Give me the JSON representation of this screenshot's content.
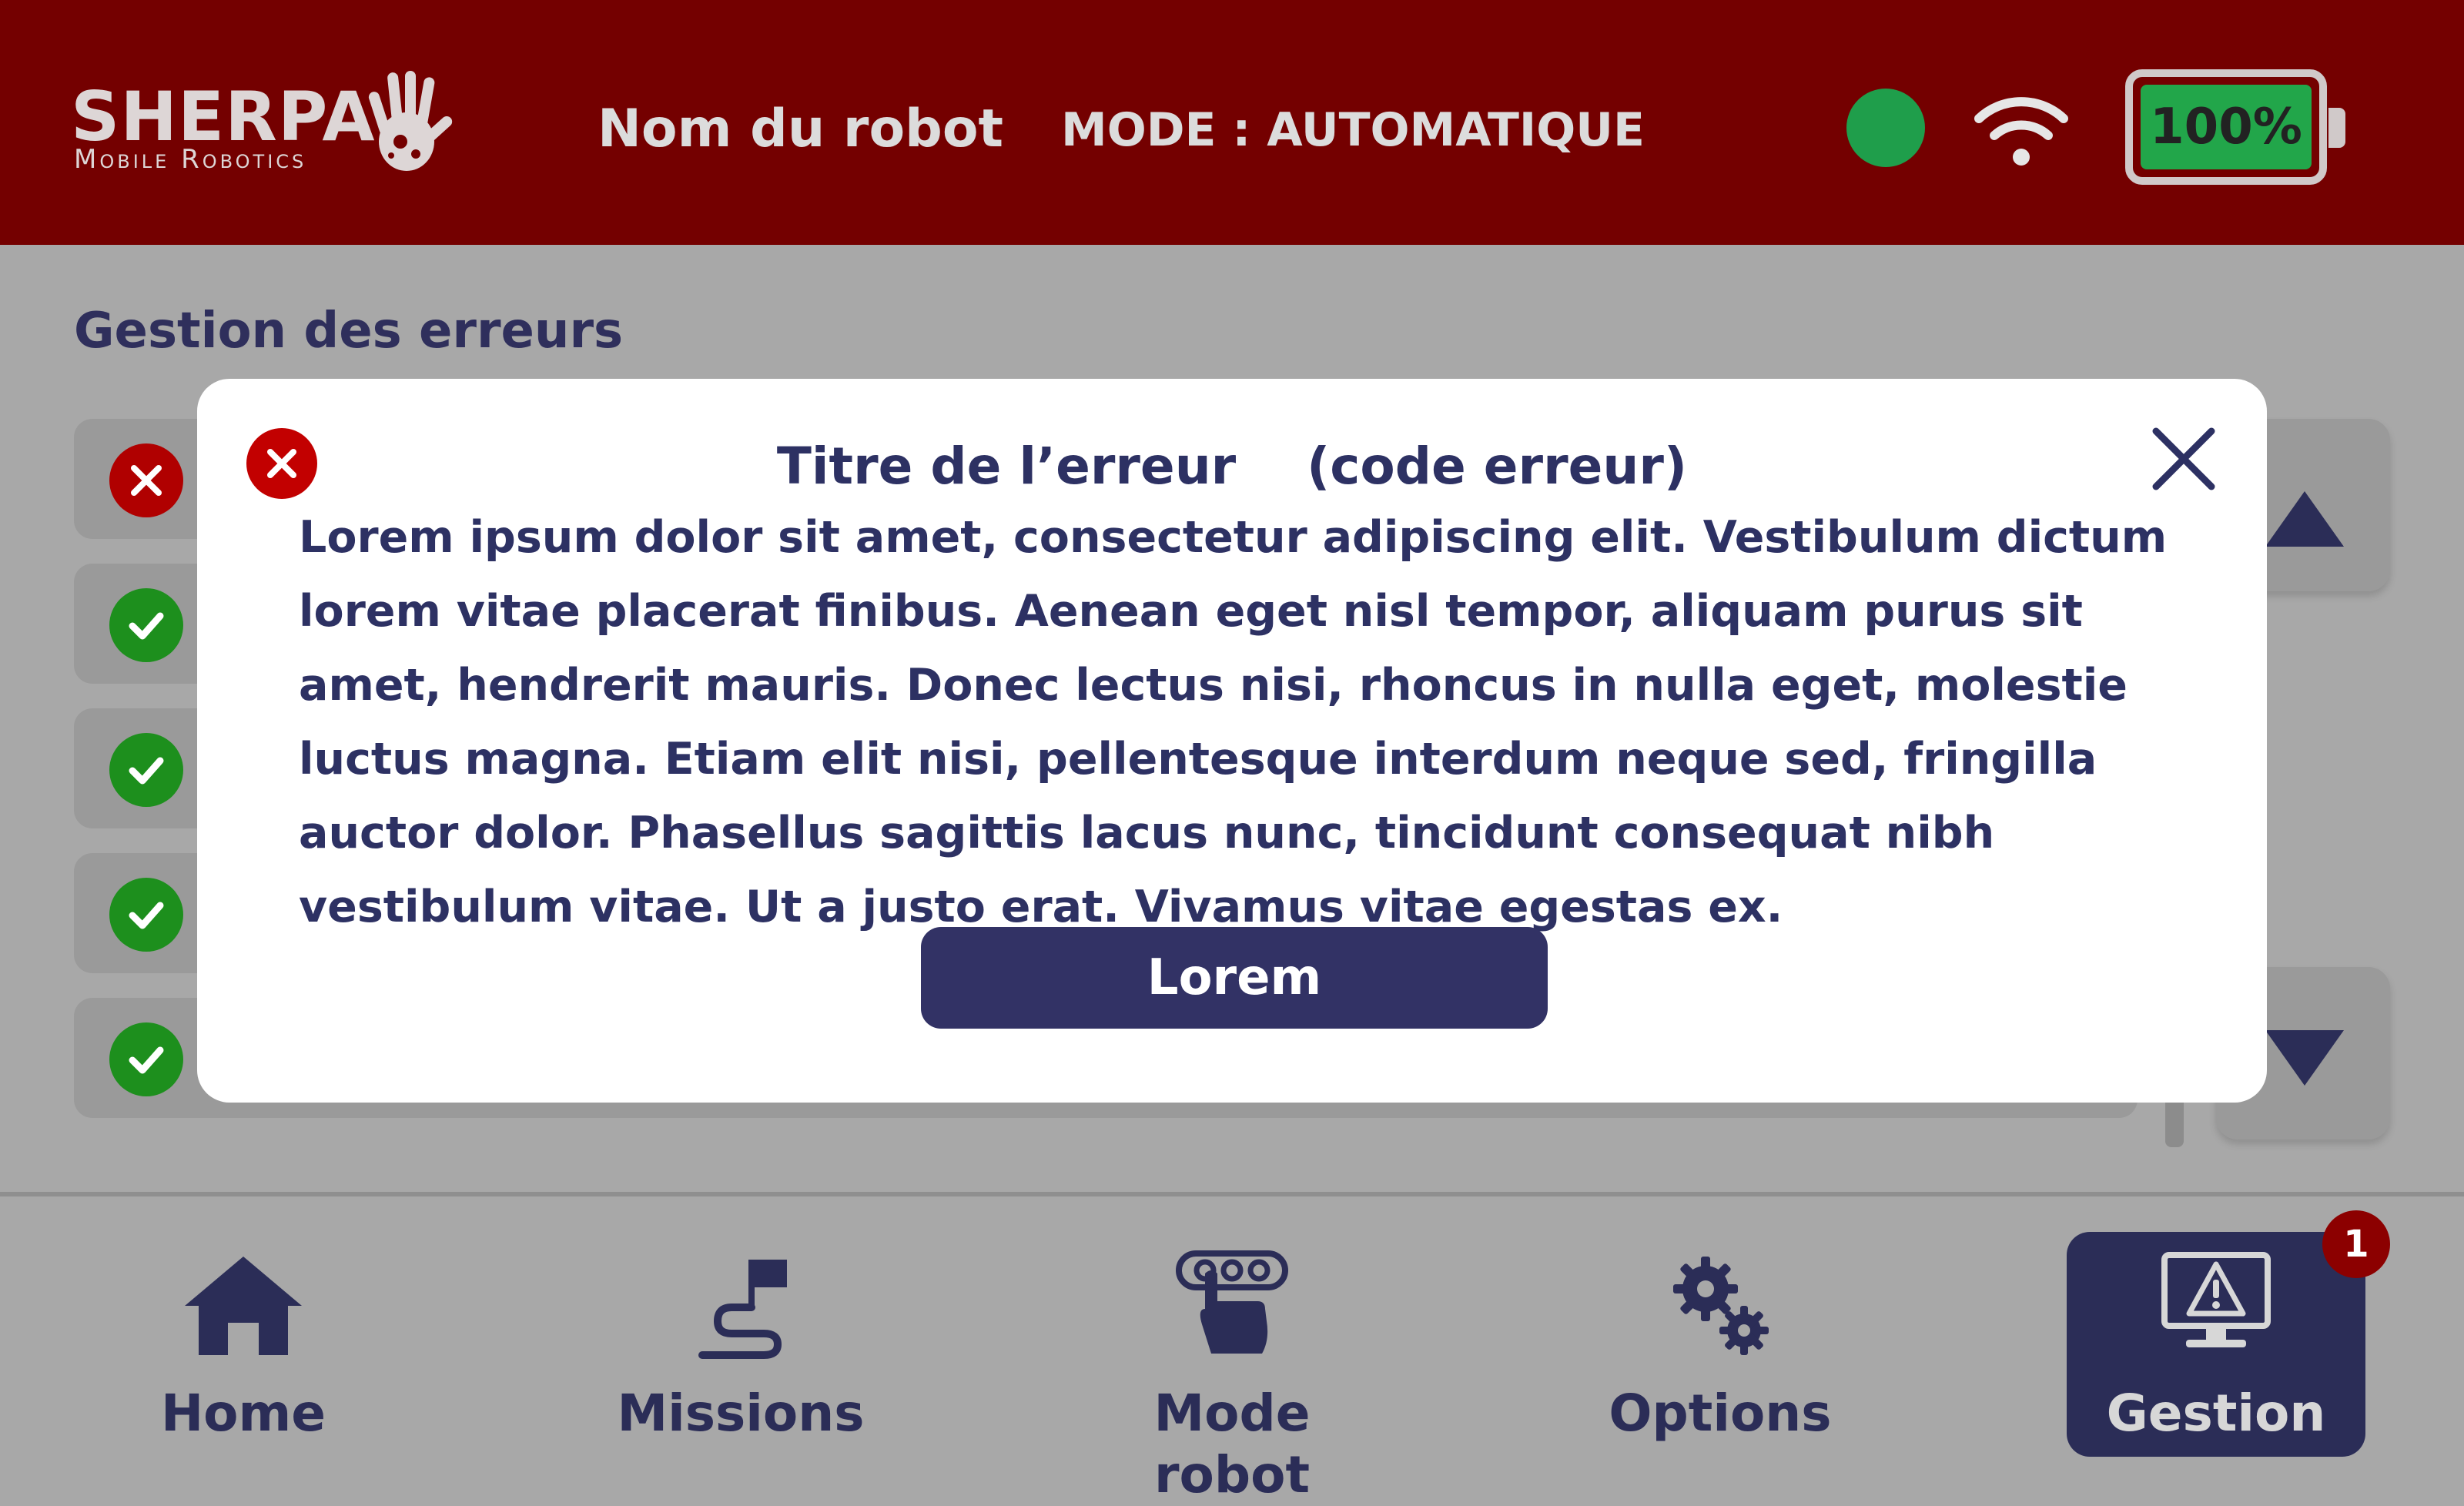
{
  "header": {
    "logo_title": "SHERPA",
    "logo_subtitle": "Mobile Robotics",
    "robot_name": "Nom du robot",
    "mode": "MODE : AUTOMATIQUE",
    "status_color": "#1f9e4b",
    "battery_level": "100%",
    "icons": [
      "hand-logo-icon",
      "wifi-icon",
      "battery-icon"
    ]
  },
  "main": {
    "section_title": "Gestion des erreurs",
    "rows": [
      {
        "status": "error"
      },
      {
        "status": "ok"
      },
      {
        "status": "ok"
      },
      {
        "status": "ok"
      },
      {
        "status": "ok"
      }
    ]
  },
  "modal": {
    "title": "Titre de l’erreur    (code erreur)",
    "body": "Lorem ipsum dolor sit amet, consectetur adipiscing elit. Vestibulum dictum lorem vitae placerat finibus. Aenean eget nisl tempor, aliquam purus sit amet, hendrerit mauris. Donec lectus nisi, rhoncus in nulla eget, molestie luctus magna. Etiam elit nisi, pellentesque interdum neque sed, fringilla auctor dolor. Phasellus sagittis lacus nunc, tincidunt consequat nibh vestibulum vitae. Ut a justo erat. Vivamus vitae egestas ex.",
    "button_label": "Lorem"
  },
  "nav": {
    "items": [
      {
        "label": "Home",
        "icon": "home-icon"
      },
      {
        "label": "Missions",
        "icon": "mission-flag-icon"
      },
      {
        "label": "Mode robot",
        "icon": "robot-control-icon"
      },
      {
        "label": "Options",
        "icon": "gears-icon"
      },
      {
        "label": "Gestion",
        "icon": "warning-monitor-icon",
        "active": true
      }
    ],
    "badge_count": "1"
  },
  "colors": {
    "header_bg": "#740000",
    "accent_navy": "#2b2d57",
    "error_red": "#c20000",
    "ok_green": "#1d8f1d"
  }
}
